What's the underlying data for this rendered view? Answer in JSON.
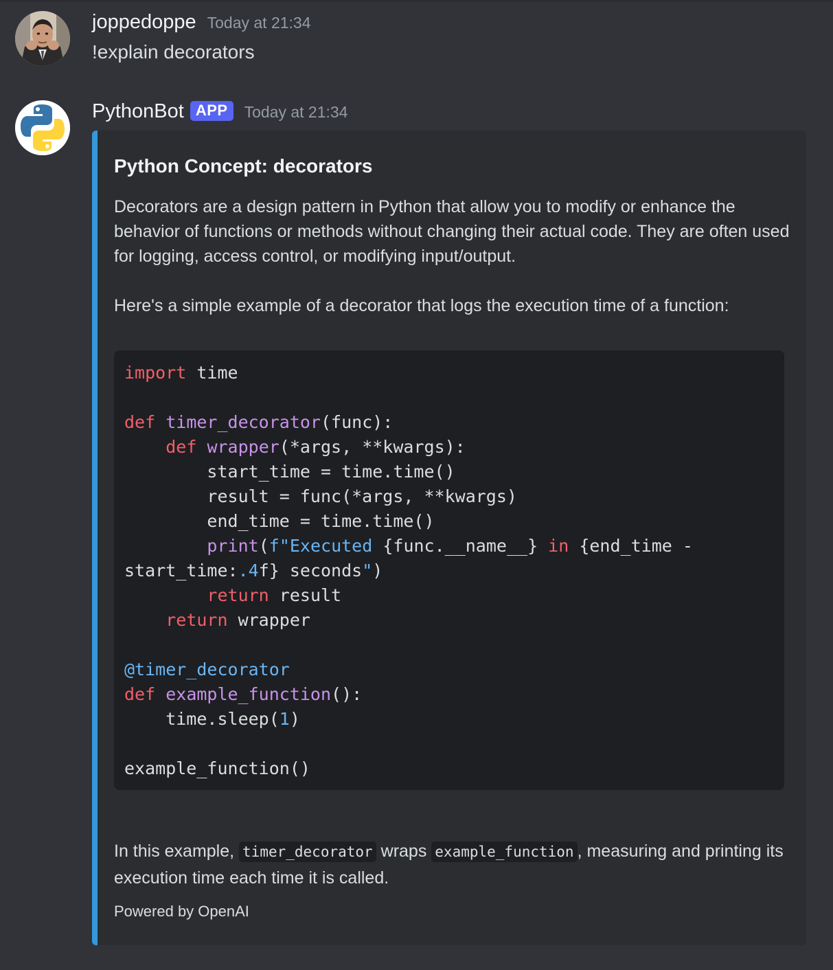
{
  "messages": [
    {
      "username": "joppedoppe",
      "timestamp": "Today at 21:34",
      "content": "!explain decorators"
    },
    {
      "username": "PythonBot",
      "badge": "APP",
      "timestamp": "Today at 21:34",
      "embed": {
        "accent_color": "#3498db",
        "title": "Python Concept: decorators",
        "description_p1": "Decorators are a design pattern in Python that allow you to modify or enhance the behavior of functions or methods without changing their actual code. They are often used for logging, access control, or modifying input/output.",
        "description_p2": "Here's a simple example of a decorator that logs the execution time of a function:",
        "code_language": "python",
        "code_lines": [
          "import time",
          "",
          "def timer_decorator(func):",
          "    def wrapper(*args, **kwargs):",
          "        start_time = time.time()",
          "        result = func(*args, **kwargs)",
          "        end_time = time.time()",
          "        print(f\"Executed {func.__name__} in {end_time - start_time:.4f} seconds\")",
          "        return result",
          "    return wrapper",
          "",
          "@timer_decorator",
          "def example_function():",
          "    time.sleep(1)",
          "",
          "example_function()"
        ],
        "summary_prefix": "In this example, ",
        "summary_code1": "timer_decorator",
        "summary_mid": " wraps ",
        "summary_code2": "example_function",
        "summary_suffix": ", measuring and printing its execution time each time it is called.",
        "footer": "Powered by OpenAI"
      }
    }
  ]
}
